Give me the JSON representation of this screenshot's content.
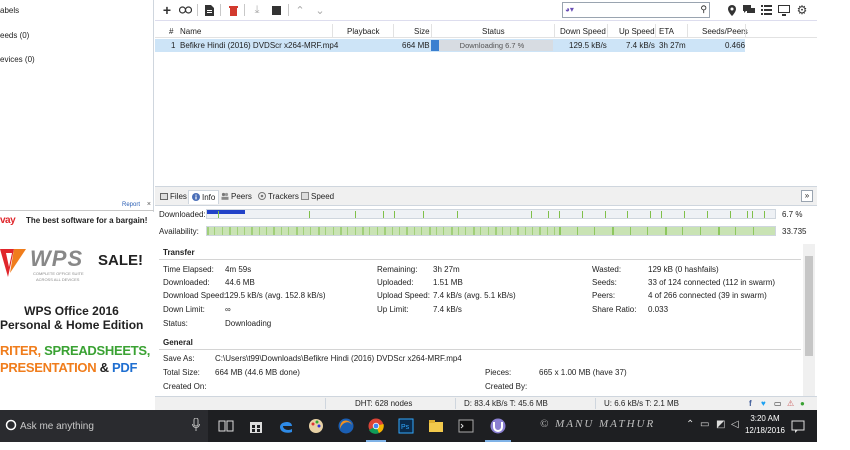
{
  "sidebar": {
    "items": [
      {
        "label": "abels"
      },
      {
        "label": "eeds (0)"
      },
      {
        "label": "evices (0)"
      }
    ],
    "ad_report": "Report",
    "ad_close": "×"
  },
  "ad": {
    "brand": "vay",
    "tagline": "The best software for a bargain!",
    "product_logo": "WPS",
    "logo_sub1": "COMPLETE OFFICE SUITE",
    "logo_sub2": "ACROSS ALL DEVICES",
    "sale": "SALE!",
    "title": "WPS Office 2016",
    "edition": "Personal & Home Edition",
    "line1_a": "RITER, ",
    "line1_b": "SPREADSHEETS,",
    "line2_a": "PRESENTATION",
    "line2_b": " & ",
    "line2_c": "PDF",
    "colors": {
      "red": "#e0262b",
      "green": "#3aa233",
      "orange": "#f07d1c",
      "blue": "#1f6fd1"
    }
  },
  "toolbar": {
    "buttons": [
      "add-torrent-icon",
      "add-link-icon",
      "create-torrent-icon",
      "remove-icon",
      "start-icon",
      "stop-icon",
      "move-up-icon",
      "move-down-icon"
    ],
    "search_provider_icon": "search-provider-icon",
    "search_value": "",
    "right_icons": [
      "location-icon",
      "chat-icon",
      "list-view-icon",
      "remote-icon",
      "settings-icon"
    ]
  },
  "list": {
    "columns": [
      "#",
      "Name",
      "Playback",
      "Size",
      "Status",
      "Down Speed",
      "Up Speed",
      "ETA",
      "Seeds/Peers"
    ],
    "rows": [
      {
        "index": "1",
        "name": "Befikre Hindi (2016) DVDScr x264-MRF.mp4",
        "size": "664 MB",
        "status": "Downloading 6.7 %",
        "progress": 0.067,
        "down_speed": "129.5 kB/s",
        "up_speed": "7.4 kB/s",
        "eta": "3h 27m",
        "seeds_peers": "0.466"
      }
    ]
  },
  "tabs": [
    {
      "label": "Files",
      "icon": "files-icon"
    },
    {
      "label": "Info",
      "icon": "info-icon",
      "active": true
    },
    {
      "label": "Peers",
      "icon": "peers-icon"
    },
    {
      "label": "Trackers",
      "icon": "trackers-icon"
    },
    {
      "label": "Speed",
      "icon": "speed-icon"
    }
  ],
  "bars": {
    "downloaded_label": "Downloaded:",
    "downloaded_value": "6.7 %",
    "availability_label": "Availability:",
    "availability_value": "33.735",
    "colors": {
      "downloaded": "#2142c8",
      "available_light": "#c9e3b4",
      "available_dark": "#7fbf4a"
    }
  },
  "transfer": {
    "heading": "Transfer",
    "time_elapsed_label": "Time Elapsed:",
    "time_elapsed": "4m 59s",
    "downloaded_label": "Downloaded:",
    "downloaded": "44.6 MB",
    "download_speed_label": "Download Speed:",
    "download_speed": "129.5 kB/s (avg. 152.8 kB/s)",
    "down_limit_label": "Down Limit:",
    "down_limit": "∞",
    "status_label": "Status:",
    "status": "Downloading",
    "remaining_label": "Remaining:",
    "remaining": "3h 27m",
    "uploaded_label": "Uploaded:",
    "uploaded": "1.51 MB",
    "upload_speed_label": "Upload Speed:",
    "upload_speed": "7.4 kB/s (avg. 5.1 kB/s)",
    "up_limit_label": "Up Limit:",
    "up_limit": "7.4 kB/s",
    "wasted_label": "Wasted:",
    "wasted": "129 kB (0 hashfails)",
    "seeds_label": "Seeds:",
    "seeds": "33 of 124 connected (112 in swarm)",
    "peers_label": "Peers:",
    "peers": "4 of 266 connected (39 in swarm)",
    "share_ratio_label": "Share Ratio:",
    "share_ratio": "0.033"
  },
  "general": {
    "heading": "General",
    "save_as_label": "Save As:",
    "save_as": "C:\\Users\\t99\\Downloads\\Befikre Hindi (2016) DVDScr x264-MRF.mp4",
    "total_size_label": "Total Size:",
    "total_size": "664 MB (44.6 MB done)",
    "created_on_label": "Created On:",
    "created_on": "",
    "pieces_label": "Pieces:",
    "pieces": "665 x 1.00 MB (have 37)",
    "created_by_label": "Created By:",
    "created_by": ""
  },
  "statusbar": {
    "dht": "DHT: 628 nodes",
    "down": "D: 83.4 kB/s T: 45.6 MB",
    "up": "U: 6.6 kB/s T: 2.1 MB"
  },
  "taskbar": {
    "search_placeholder": "Ask me anything",
    "apps": [
      "task-view-icon",
      "store-icon",
      "edge-icon",
      "paint-icon",
      "firefox-icon",
      "chrome-icon",
      "photoshop-icon",
      "file-explorer-icon",
      "command-prompt-icon",
      "utorrent-icon"
    ],
    "watermark": "© MANU MATHUR",
    "time": "3:20 AM",
    "date": "12/18/2016"
  }
}
